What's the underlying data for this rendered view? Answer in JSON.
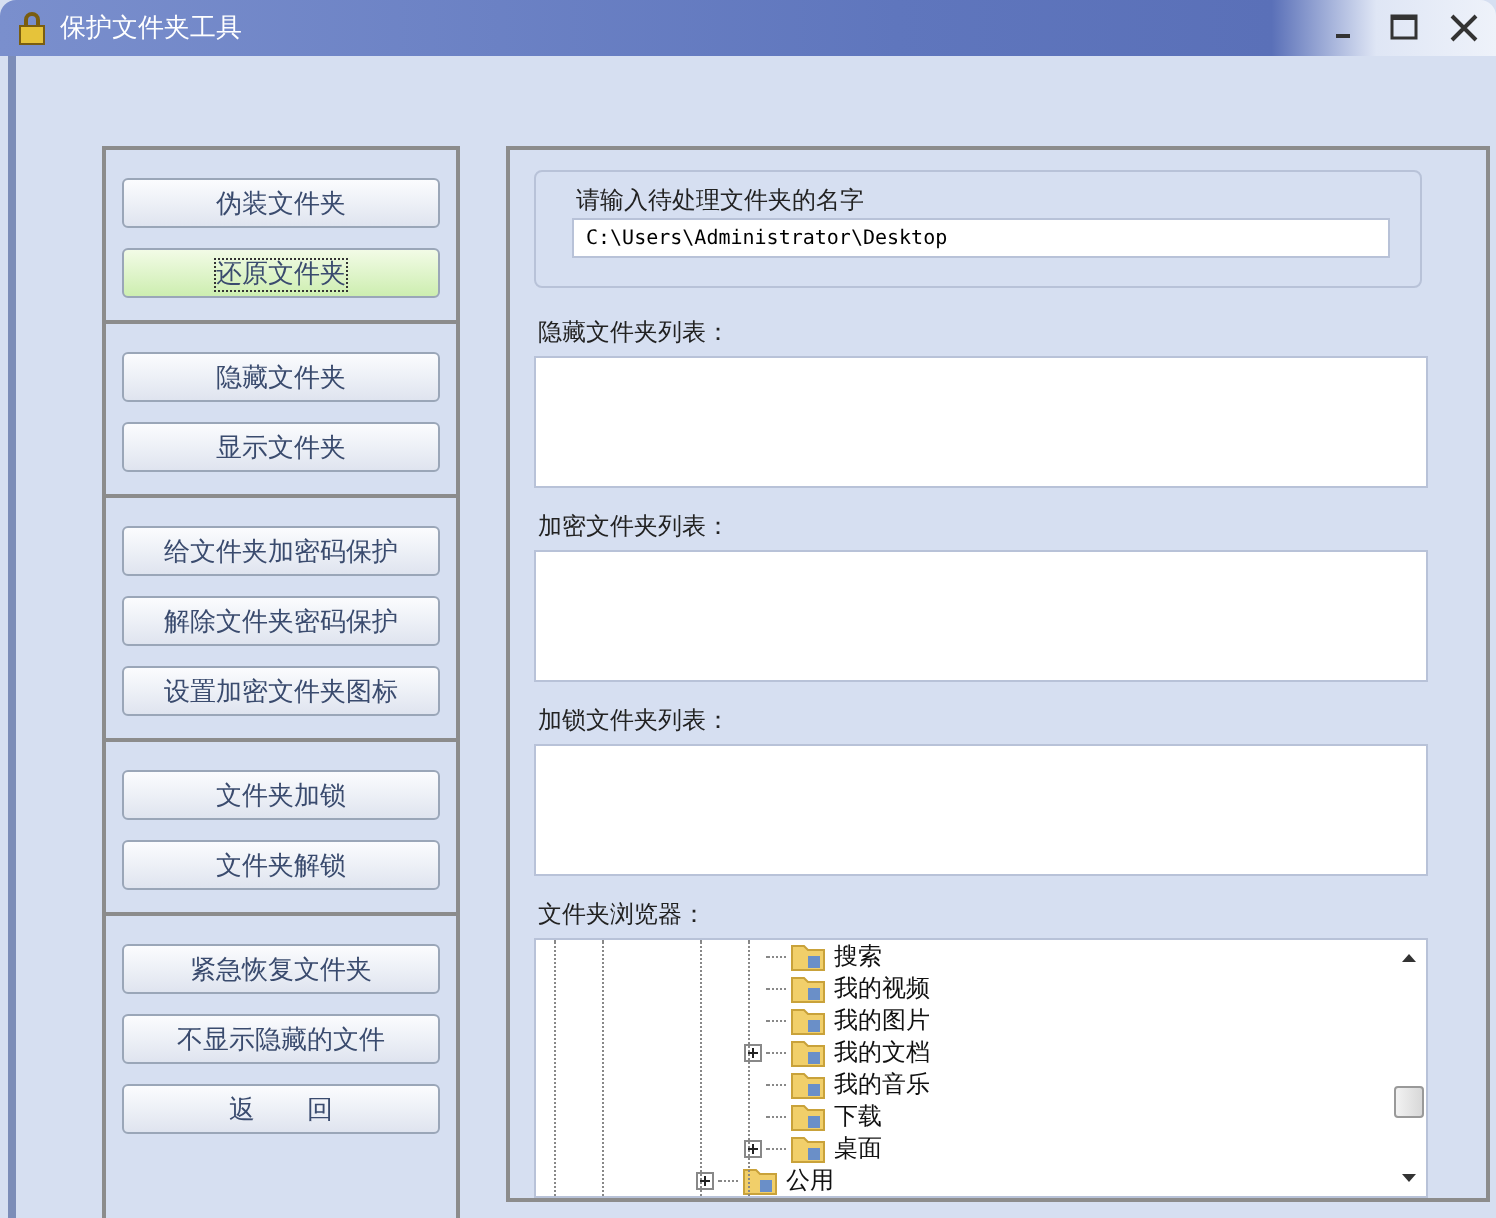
{
  "window": {
    "title": "保护文件夹工具"
  },
  "button_groups": [
    {
      "buttons": [
        {
          "label": "伪装文件夹",
          "focused": false
        },
        {
          "label": "还原文件夹",
          "focused": true
        }
      ]
    },
    {
      "buttons": [
        {
          "label": "隐藏文件夹",
          "focused": false
        },
        {
          "label": "显示文件夹",
          "focused": false
        }
      ]
    },
    {
      "buttons": [
        {
          "label": "给文件夹加密码保护",
          "focused": false
        },
        {
          "label": "解除文件夹密码保护",
          "focused": false
        },
        {
          "label": "设置加密文件夹图标",
          "focused": false
        }
      ]
    },
    {
      "buttons": [
        {
          "label": "文件夹加锁",
          "focused": false
        },
        {
          "label": "文件夹解锁",
          "focused": false
        }
      ]
    },
    {
      "buttons": [
        {
          "label": "紧急恢复文件夹",
          "focused": false
        },
        {
          "label": "不显示隐藏的文件",
          "focused": false
        },
        {
          "label": "返　　回",
          "focused": false
        }
      ]
    }
  ],
  "name_group": {
    "legend": "请输入待处理文件夹的名字",
    "value": "C:\\Users\\Administrator\\Desktop"
  },
  "lists": [
    {
      "label": "隐藏文件夹列表："
    },
    {
      "label": "加密文件夹列表："
    },
    {
      "label": "加锁文件夹列表："
    }
  ],
  "browser": {
    "label": "文件夹浏览器：",
    "tree": [
      {
        "children": [
          {
            "label": "搜索",
            "expandable": false
          },
          {
            "label": "我的视频",
            "expandable": false
          },
          {
            "label": "我的图片",
            "expandable": false
          },
          {
            "label": "我的文档",
            "expandable": true
          },
          {
            "label": "我的音乐",
            "expandable": false
          },
          {
            "label": "下载",
            "expandable": false
          },
          {
            "label": "桌面",
            "expandable": true
          }
        ]
      },
      {
        "label": "公用",
        "expandable": true
      }
    ]
  }
}
